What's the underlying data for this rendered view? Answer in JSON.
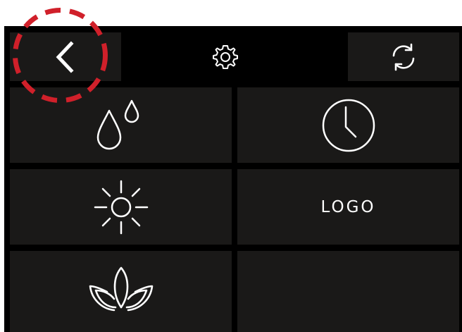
{
  "toolbar": {
    "back_icon": "chevron-left-icon",
    "settings_icon": "gear-icon",
    "refresh_icon": "refresh-icon"
  },
  "tiles": [
    {
      "icon": "water-drops-icon"
    },
    {
      "icon": "clock-icon"
    },
    {
      "icon": "sun-icon"
    },
    {
      "label": "LOGO"
    },
    {
      "icon": "lotus-icon"
    },
    {}
  ],
  "colors": {
    "background": "#000000",
    "tile": "#1a1918",
    "icon": "#ffffff",
    "highlight": "#d0202a"
  }
}
